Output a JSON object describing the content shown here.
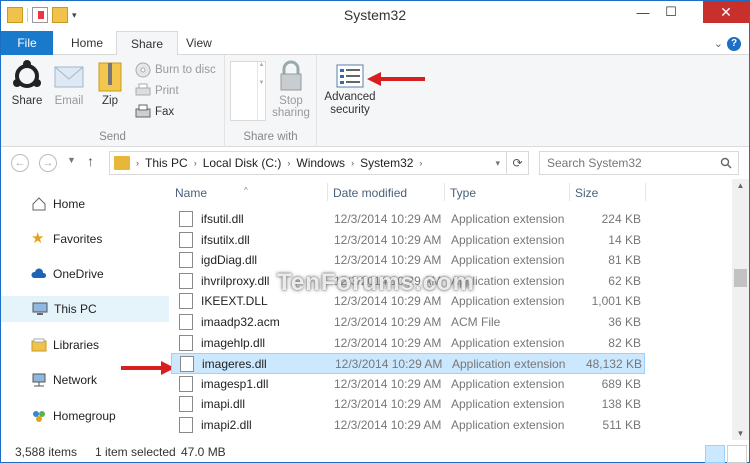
{
  "window": {
    "title": "System32",
    "close_glyph": "✕",
    "minimize_glyph": "—",
    "maximize_glyph": "☐"
  },
  "tabs": [
    {
      "label": "File"
    },
    {
      "label": "Home"
    },
    {
      "label": "Share"
    },
    {
      "label": "View"
    }
  ],
  "ribbon": {
    "share": "Share",
    "email": "Email",
    "zip": "Zip",
    "burn": "Burn to disc",
    "print": "Print",
    "fax": "Fax",
    "send_group": "Send",
    "stop_sharing": "Stop sharing",
    "share_with_group": "Share with",
    "advanced_security": "Advanced security"
  },
  "address": {
    "segments": [
      "This PC",
      "Local Disk (C:)",
      "Windows",
      "System32"
    ],
    "search_placeholder": "Search System32"
  },
  "nav": [
    {
      "label": "Home",
      "icon": "home-icon"
    },
    {
      "label": "Favorites",
      "icon": "star-icon"
    },
    {
      "label": "OneDrive",
      "icon": "cloud-icon"
    },
    {
      "label": "This PC",
      "icon": "computer-icon",
      "selected": true
    },
    {
      "label": "Libraries",
      "icon": "libraries-icon"
    },
    {
      "label": "Network",
      "icon": "network-icon"
    },
    {
      "label": "Homegroup",
      "icon": "homegroup-icon"
    }
  ],
  "columns": {
    "name": "Name",
    "date": "Date modified",
    "type": "Type",
    "size": "Size"
  },
  "files": [
    {
      "name": "ifsutil.dll",
      "date": "12/3/2014 10:29 AM",
      "type": "Application extension",
      "size": "224 KB"
    },
    {
      "name": "ifsutilx.dll",
      "date": "12/3/2014 10:29 AM",
      "type": "Application extension",
      "size": "14 KB"
    },
    {
      "name": "igdDiag.dll",
      "date": "12/3/2014 10:29 AM",
      "type": "Application extension",
      "size": "81 KB"
    },
    {
      "name": "ihvrilproxy.dll",
      "date": "12/3/2014 10:29 AM",
      "type": "Application extension",
      "size": "62 KB"
    },
    {
      "name": "IKEEXT.DLL",
      "date": "12/3/2014 10:29 AM",
      "type": "Application extension",
      "size": "1,001 KB"
    },
    {
      "name": "imaadp32.acm",
      "date": "12/3/2014 10:29 AM",
      "type": "ACM File",
      "size": "36 KB"
    },
    {
      "name": "imagehlp.dll",
      "date": "12/3/2014 10:29 AM",
      "type": "Application extension",
      "size": "82 KB"
    },
    {
      "name": "imageres.dll",
      "date": "12/3/2014 10:29 AM",
      "type": "Application extension",
      "size": "48,132 KB",
      "selected": true
    },
    {
      "name": "imagesp1.dll",
      "date": "12/3/2014 10:29 AM",
      "type": "Application extension",
      "size": "689 KB"
    },
    {
      "name": "imapi.dll",
      "date": "12/3/2014 10:29 AM",
      "type": "Application extension",
      "size": "138 KB"
    },
    {
      "name": "imapi2.dll",
      "date": "12/3/2014 10:29 AM",
      "type": "Application extension",
      "size": "511 KB"
    }
  ],
  "status": {
    "items": "3,588 items",
    "selected": "1 item selected",
    "size": "47.0 MB"
  },
  "watermark": "TenForums.com"
}
